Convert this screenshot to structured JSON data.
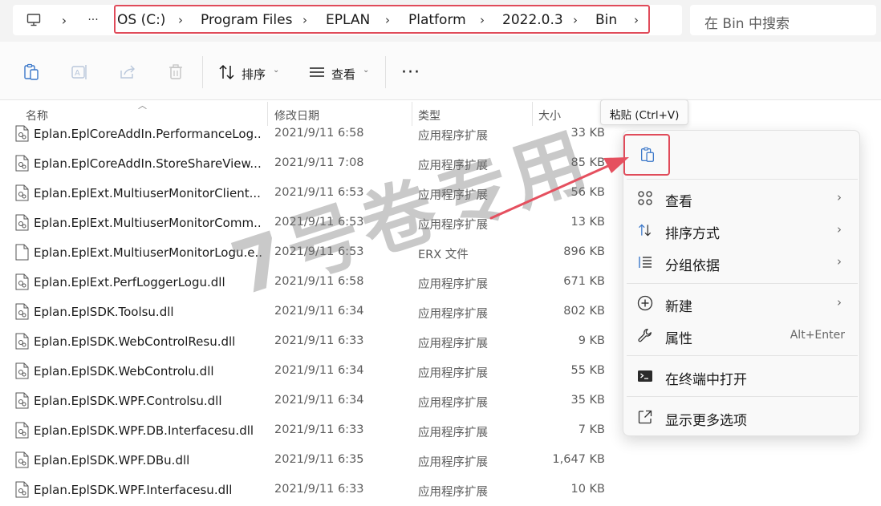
{
  "address_bar": {
    "crumbs": [
      "OS (C:)",
      "Program Files",
      "EPLAN",
      "Platform",
      "2022.0.3",
      "Bin"
    ],
    "more": "···",
    "search_placeholder": "在 Bin 中搜索",
    "highlight_color": "#e04b5a"
  },
  "toolbar": {
    "sort_label": "排序",
    "view_label": "查看",
    "more": "···"
  },
  "columns": {
    "name": "名称",
    "modified": "修改日期",
    "type": "类型",
    "size": "大小"
  },
  "files": [
    {
      "name": "Eplan.EplCoreAddIn.PerformanceLog...",
      "modified": "2021/9/11 6:58",
      "type": "应用程序扩展",
      "size": "33 KB"
    },
    {
      "name": "Eplan.EplCoreAddIn.StoreShareView...",
      "modified": "2021/9/11 7:08",
      "type": "应用程序扩展",
      "size": "85 KB"
    },
    {
      "name": "Eplan.EplExt.MultiuserMonitorClient...",
      "modified": "2021/9/11 6:53",
      "type": "应用程序扩展",
      "size": "56 KB"
    },
    {
      "name": "Eplan.EplExt.MultiuserMonitorComm...",
      "modified": "2021/9/11 6:53",
      "type": "应用程序扩展",
      "size": "13 KB"
    },
    {
      "name": "Eplan.EplExt.MultiuserMonitorLogu.e...",
      "modified": "2021/9/11 6:53",
      "type": "ERX 文件",
      "size": "896 KB"
    },
    {
      "name": "Eplan.EplExt.PerfLoggerLogu.dll",
      "modified": "2021/9/11 6:58",
      "type": "应用程序扩展",
      "size": "671 KB"
    },
    {
      "name": "Eplan.EplSDK.Toolsu.dll",
      "modified": "2021/9/11 6:34",
      "type": "应用程序扩展",
      "size": "802 KB"
    },
    {
      "name": "Eplan.EplSDK.WebControlResu.dll",
      "modified": "2021/9/11 6:33",
      "type": "应用程序扩展",
      "size": "9 KB"
    },
    {
      "name": "Eplan.EplSDK.WebControlu.dll",
      "modified": "2021/9/11 6:34",
      "type": "应用程序扩展",
      "size": "55 KB"
    },
    {
      "name": "Eplan.EplSDK.WPF.Controlsu.dll",
      "modified": "2021/9/11 6:34",
      "type": "应用程序扩展",
      "size": "35 KB"
    },
    {
      "name": "Eplan.EplSDK.WPF.DB.Interfacesu.dll",
      "modified": "2021/9/11 6:33",
      "type": "应用程序扩展",
      "size": "7 KB"
    },
    {
      "name": "Eplan.EplSDK.WPF.DBu.dll",
      "modified": "2021/9/11 6:35",
      "type": "应用程序扩展",
      "size": "1,647 KB"
    },
    {
      "name": "Eplan.EplSDK.WPF.Interfacesu.dll",
      "modified": "2021/9/11 6:33",
      "type": "应用程序扩展",
      "size": "10 KB"
    }
  ],
  "watermark": "7号卷专用",
  "tooltip": "粘贴 (Ctrl+V)",
  "context_menu": {
    "paste_icon": "paste-icon",
    "items": [
      {
        "label": "查看",
        "icon": "grid-view-icon",
        "submenu": true
      },
      {
        "label": "排序方式",
        "icon": "sort-icon",
        "submenu": true
      },
      {
        "label": "分组依据",
        "icon": "group-icon",
        "submenu": true
      },
      {
        "label": "新建",
        "icon": "new-icon",
        "submenu": true
      },
      {
        "label": "属性",
        "icon": "wrench-icon",
        "shortcut": "Alt+Enter"
      },
      {
        "label": "在终端中打开",
        "icon": "terminal-icon"
      },
      {
        "label": "显示更多选项",
        "icon": "open-external-icon"
      }
    ]
  }
}
